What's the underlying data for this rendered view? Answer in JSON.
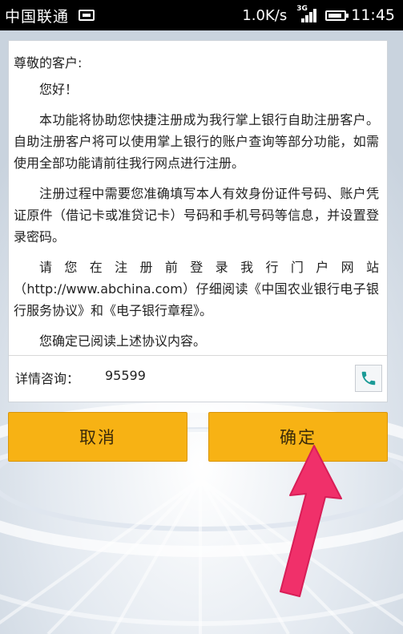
{
  "status_bar": {
    "carrier": "中国联通",
    "speed": "1.0K/s",
    "network_type": "3G",
    "time": "11:45"
  },
  "notice": {
    "salutation": "尊敬的客户:",
    "greeting": "您好！",
    "paragraphs": [
      "本功能将协助您快捷注册成为我行掌上银行自助注册客户。自助注册客户将可以使用掌上银行的账户查询等部分功能，如需使用全部功能请前往我行网点进行注册。",
      "注册过程中需要您准确填写本人有效身份证件号码、账户凭证原件（借记卡或准贷记卡）号码和手机号码等信息，并设置登录密码。",
      "请您在注册前登录我行门户网站（http://www.abchina.com）仔细阅读《中国农业银行电子银行服务协议》和《电子银行章程》。",
      "您确定已阅读上述协议内容。"
    ]
  },
  "contact": {
    "label": "详情咨询：",
    "number": "95599",
    "icon": "phone-icon"
  },
  "buttons": {
    "cancel_label": "取消",
    "confirm_label": "确定"
  },
  "colors": {
    "button_fill": "#f7b214",
    "phone_icon": "#1a9a96",
    "arrow": "#f0306a"
  }
}
